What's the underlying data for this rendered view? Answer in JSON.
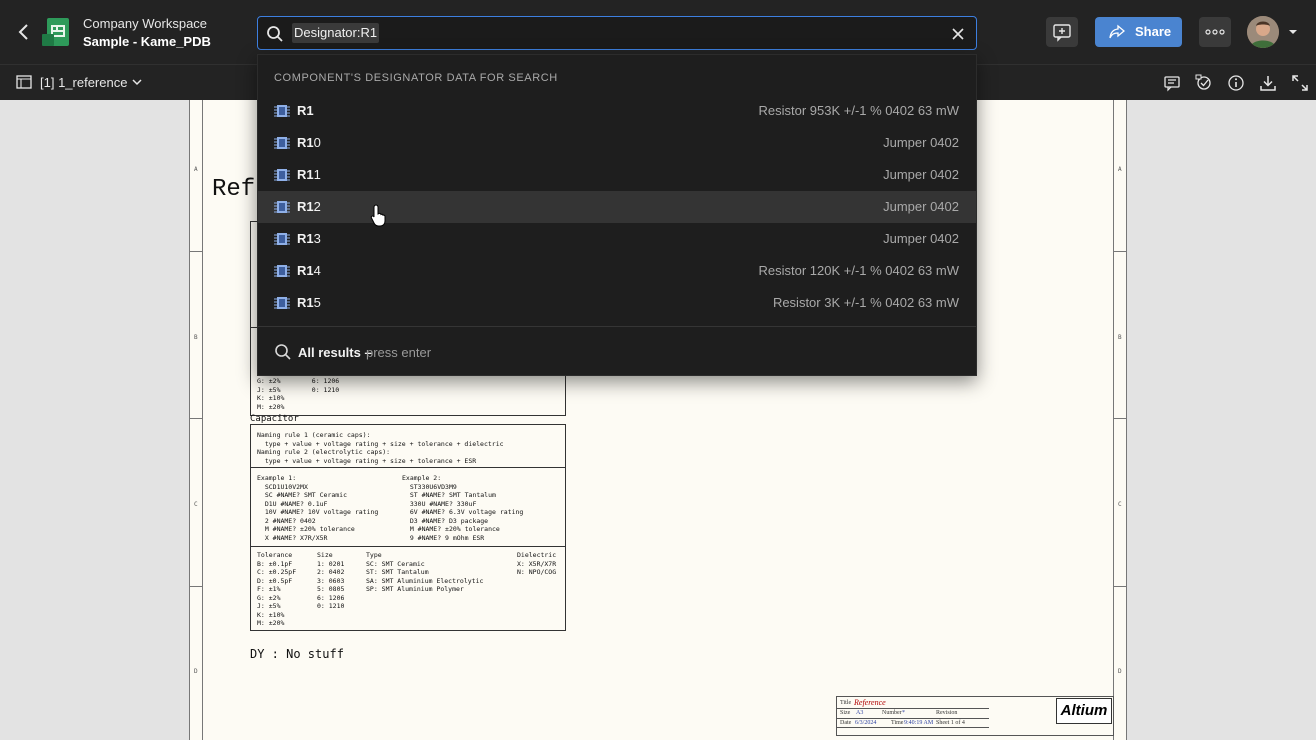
{
  "header": {
    "workspace": "Company Workspace",
    "project": "Sample - Kame_PDB",
    "search_value": "Designator:R1",
    "share_label": "Share"
  },
  "subbar": {
    "document_label": "[1] 1_reference"
  },
  "dropdown": {
    "heading": "COMPONENT'S DESIGNATOR DATA FOR SEARCH",
    "items": [
      {
        "match": "R1",
        "rest": "",
        "desc": "Resistor 953K +/-1 % 0402 63 mW"
      },
      {
        "match": "R1",
        "rest": "0",
        "desc": "Jumper 0402"
      },
      {
        "match": "R1",
        "rest": "1",
        "desc": "Jumper 0402"
      },
      {
        "match": "R1",
        "rest": "2",
        "desc": "Jumper 0402"
      },
      {
        "match": "R1",
        "rest": "3",
        "desc": "Jumper 0402"
      },
      {
        "match": "R1",
        "rest": "4",
        "desc": "Resistor 120K +/-1 % 0402 63 mW"
      },
      {
        "match": "R1",
        "rest": "5",
        "desc": "Resistor 3K +/-1 % 0402 63 mW"
      }
    ],
    "hovered_index": 3,
    "all_results": "All results –",
    "all_results_hint": "press enter"
  },
  "sheet": {
    "title_partial": "Ref",
    "zone_letters": [
      "A",
      "B",
      "C",
      "D"
    ],
    "upper_partial_lines": [
      "G: ±2%        6: 1206",
      "J: ±5%        0: 1210",
      "K: ±10%",
      "M: ±20%"
    ],
    "capacitor_label": "Capacitor",
    "cap_rules": "Naming rule 1 (ceramic caps):\n  type + value + voltage rating + size + tolerance + dielectric\nNaming rule 2 (electrolytic caps):\n  type + value + voltage rating + size + tolerance + ESR",
    "cap_example1": "Example 1:\n  SCD1U10V2MX\n  SC #NAME? SMT Ceramic\n  D1U #NAME? 0.1uF\n  10V #NAME? 10V voltage rating\n  2 #NAME? 0402\n  M #NAME? ±20% tolerance\n  X #NAME? X7R/X5R",
    "cap_example2": "Example 2:\n  ST330U6VD3M9\n  ST #NAME? SMT Tantalum\n  330U #NAME? 330uF\n  6V #NAME? 6.3V voltage rating\n  D3 #NAME? D3 package\n  M #NAME? ±20% tolerance\n  9 #NAME? 9 mOhm ESR",
    "cap_tolerance": "Tolerance\nB: ±0.1pF\nC: ±0.25pF\nD: ±0.5pF\nF: ±1%\nG: ±2%\nJ: ±5%\nK: ±10%\nM: ±20%",
    "cap_size": "Size\n1: 0201\n2: 0402\n3: 0603\n5: 0805\n6: 1206\n0: 1210",
    "cap_type": "Type\nSC: SMT Ceramic\nST: SMT Tantalum\nSA: SMT Aluminium Electrolytic\nSP: SMT Aluminium Polymer",
    "cap_dielectric": "Dielectric\nX: X5R/X7R\nN: NPO/COG",
    "dy_note": "DY : No stuff",
    "tb_title_label": "Title",
    "tb_title": "Reference",
    "tb_size_label": "Size",
    "tb_size": "A3",
    "tb_number_label": "Number",
    "tb_number": "*",
    "tb_revision_label": "Revision",
    "tb_date_label": "Date",
    "tb_date": "6/3/2024",
    "tb_time_label": "Time",
    "tb_time": "9:40:19 AM",
    "tb_sheet": "Sheet 1   of   4",
    "logo_text": "Altium"
  },
  "icons": {
    "back": "chevron-left-icon",
    "search": "search-icon",
    "clear": "close-icon",
    "comment": "add-comment-icon",
    "more": "more-icon",
    "download": "download-icon",
    "fullscreen": "expand-icon"
  },
  "colors": {
    "accent": "#4a84d0",
    "bar": "#232323",
    "dropdown": "#1e1e1e",
    "chip_icon": "#8fb0e8"
  }
}
